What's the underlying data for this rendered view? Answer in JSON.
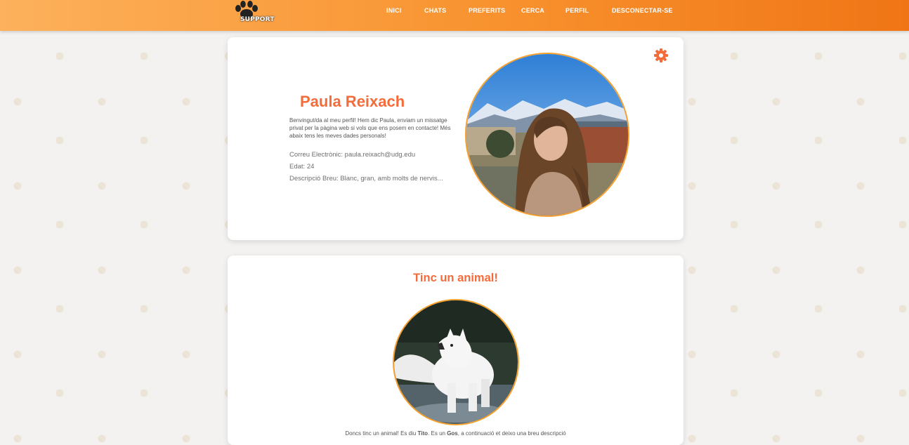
{
  "nav": {
    "logo_text": "SUPPORT",
    "links": [
      {
        "label": "INICI"
      },
      {
        "label": "CHATS"
      },
      {
        "label": "PREFERITS"
      },
      {
        "label": "CERCA"
      },
      {
        "label": "PERFIL"
      },
      {
        "label": "DESCONECTAR-SE"
      }
    ]
  },
  "profile": {
    "name": "Paula Reixach",
    "welcome": "Benvingut/da al meu perfil! Hem dic Paula, enviam un missatge privat per la pàgina web si vols que ens posem en contacte! Més abaix tens les meves dades personals!",
    "email_line": "Correu Electrònic: paula.reixach@udg.edu",
    "age_line": "Edat: 24",
    "description_line": "Descripció Breu: Blanc, gran, amb molts de nervis..."
  },
  "animal": {
    "title": "Tinc un animal!",
    "desc_prefix": "Doncs tinc un animal! Es diu ",
    "pet_name": "Tito",
    "desc_mid": ". Es un ",
    "pet_type": "Gos",
    "desc_suffix": ", a continuació et deixo una breu descripció"
  },
  "colors": {
    "accent": "#f56c3a",
    "nav_gradient_start": "#fdb15c",
    "nav_gradient_end": "#f07515",
    "photo_border": "#f7a12c"
  },
  "icons": [
    "paw-logo-icon",
    "gear-icon"
  ]
}
